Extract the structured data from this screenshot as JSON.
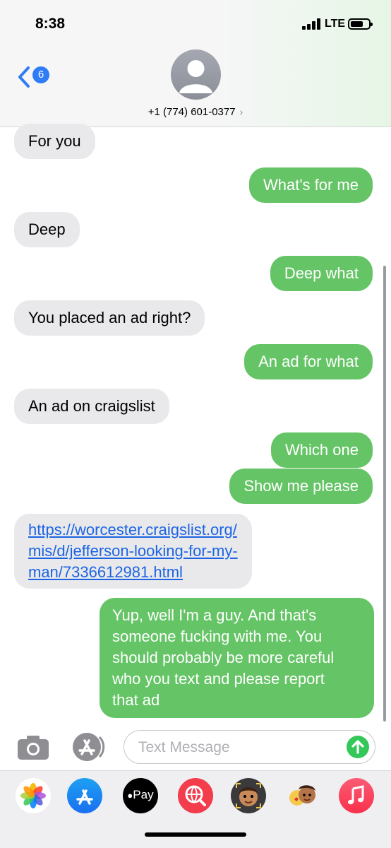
{
  "status": {
    "time": "8:38",
    "network": "LTE"
  },
  "header": {
    "back_count": "6",
    "contact": "+1 (774) 601-0377",
    "chevron": "›"
  },
  "messages": [
    {
      "dir": "in",
      "text": "For you"
    },
    {
      "dir": "out",
      "text": "What's for me"
    },
    {
      "dir": "in",
      "text": "Deep"
    },
    {
      "dir": "out",
      "text": "Deep what"
    },
    {
      "dir": "in",
      "text": "You placed an ad right?"
    },
    {
      "dir": "out",
      "text": "An ad for what"
    },
    {
      "dir": "in",
      "text": "An ad on craigslist"
    },
    {
      "dir": "out",
      "text": "Which one"
    },
    {
      "dir": "out",
      "text": "Show me please"
    },
    {
      "dir": "in",
      "link_lines": [
        "https://worcester.craigslist.org/",
        "mis/d/jefferson-looking-for-my-",
        "man/7336612981.html"
      ]
    },
    {
      "dir": "out",
      "lines": [
        "Yup, well I'm a guy. And that's",
        "someone fucking with me. You",
        "should probably be more careful",
        "who you text and please report",
        "that ad"
      ]
    }
  ],
  "input": {
    "placeholder": "Text Message"
  },
  "drawer": {
    "apple_pay_label": "Pay",
    "apps": [
      "photos-app",
      "app-store-app",
      "apple-pay-app",
      "web-search-app",
      "memoji-app",
      "memoji-stickers-app",
      "music-app"
    ]
  },
  "colors": {
    "incoming": "#e9e9eb",
    "outgoing": "#65c466",
    "link": "#1c64e4",
    "badge": "#2f7cf6"
  }
}
